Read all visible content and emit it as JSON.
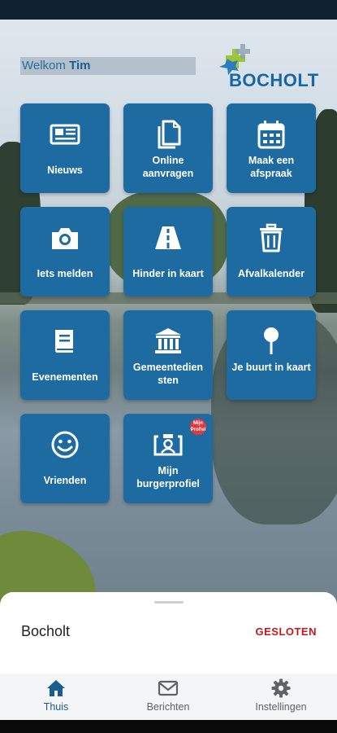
{
  "header": {
    "welcome_prefix": "Welkom ",
    "welcome_name": "Tim",
    "logo_text": "BOCHOLT"
  },
  "tiles": [
    {
      "label": "Nieuws",
      "icon": "newspaper-icon"
    },
    {
      "label": "Online aanvragen",
      "icon": "documents-icon"
    },
    {
      "label": "Maak een afspraak",
      "icon": "calendar-icon"
    },
    {
      "label": "Iets melden",
      "icon": "camera-icon"
    },
    {
      "label": "Hinder in kaart",
      "icon": "road-icon"
    },
    {
      "label": "Afvalkalender",
      "icon": "trash-icon"
    },
    {
      "label": "Evenementen",
      "icon": "book-icon"
    },
    {
      "label": "Gemeentediensten",
      "icon": "town-hall-icon"
    },
    {
      "label": "Je buurt in kaart",
      "icon": "map-pin-icon"
    },
    {
      "label": "Vrienden",
      "icon": "smiley-icon"
    },
    {
      "label": "Mijn burgerprofiel",
      "icon": "profile-card-icon",
      "badge": "Mijn Profiel"
    }
  ],
  "sheet": {
    "place": "Bocholt",
    "status": "GESLOTEN"
  },
  "tabs": [
    {
      "label": "Thuis",
      "icon": "home-icon",
      "active": true
    },
    {
      "label": "Berichten",
      "icon": "mail-icon",
      "active": false
    },
    {
      "label": "Instellingen",
      "icon": "gear-icon",
      "active": false
    }
  ],
  "colors": {
    "tile": "#1e6ba2",
    "active_tab": "#1b5c8f",
    "inactive_tab": "#5f6368",
    "status_closed": "#c4191f"
  }
}
